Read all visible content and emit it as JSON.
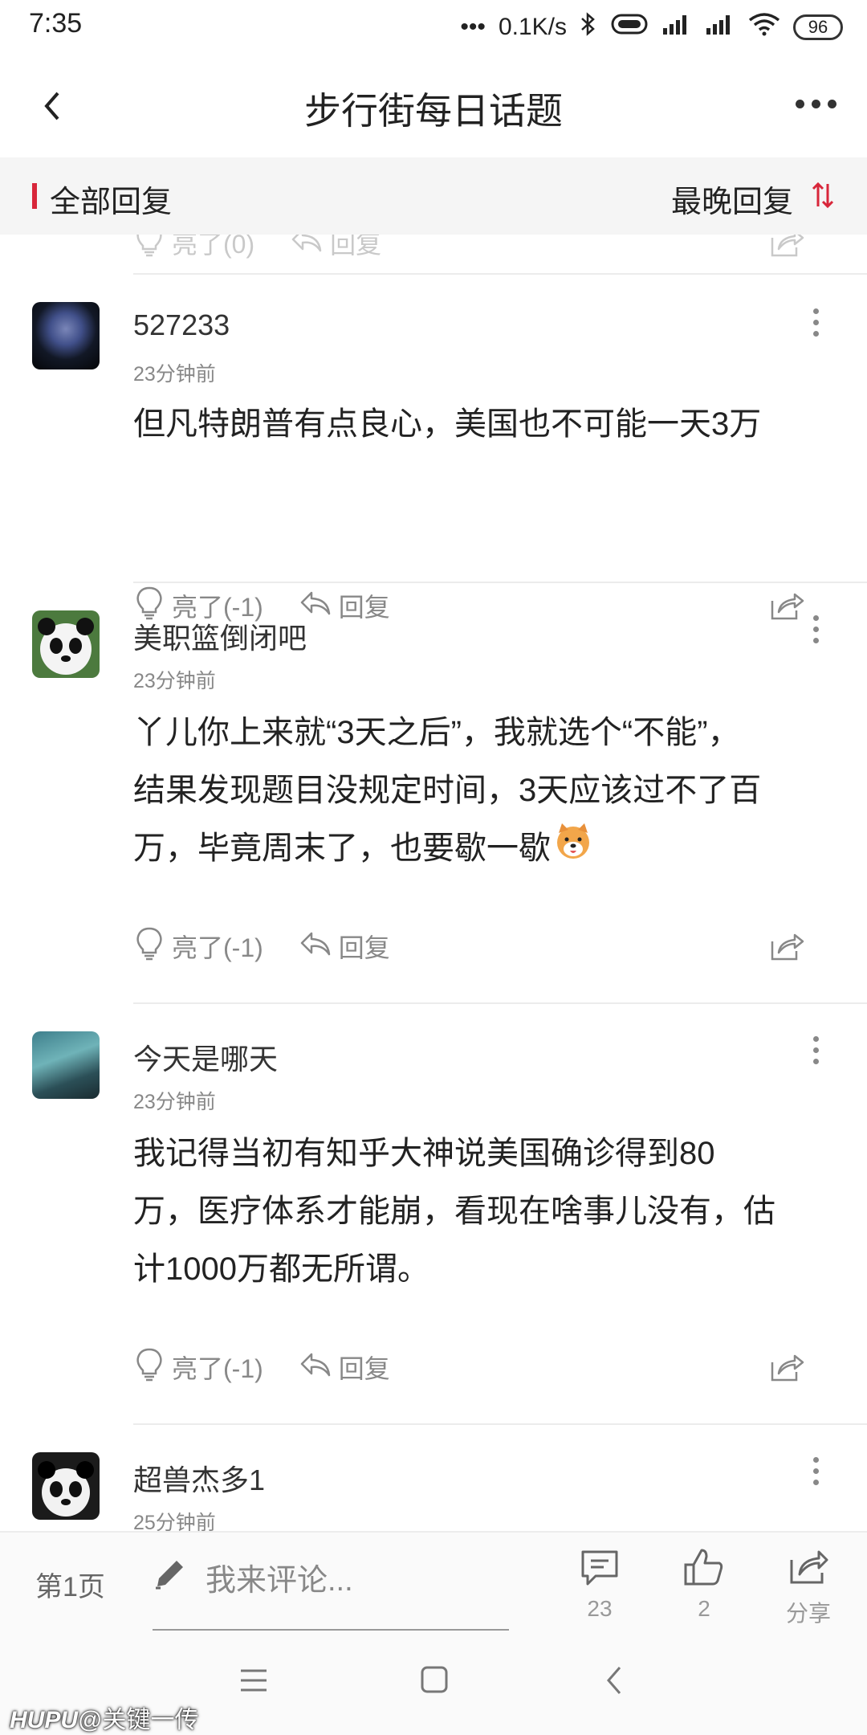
{
  "status_bar": {
    "time": "7:35",
    "speed": "0.1K/s",
    "battery": "96"
  },
  "header": {
    "title": "步行街每日话题"
  },
  "filter": {
    "label": "全部回复",
    "sort": "最晚回复"
  },
  "ghost_actions": {
    "like": "亮了(0)",
    "reply": "回复"
  },
  "posts": [
    {
      "user": "527233",
      "time": "23分钟前",
      "lines": [
        "但凡特朗普有点良心，美国也不可能一天3万"
      ],
      "like": "亮了(-1)",
      "reply": "回复"
    },
    {
      "user": "美职篮倒闭吧",
      "time": "23分钟前",
      "lines": [
        "丫儿你上来就“3天之后”，我就选个“不能”，",
        "结果发现题目没规定时间，3天应该过不了百",
        "万，毕竟周末了，也要歇一歇"
      ],
      "like": "亮了(-1)",
      "reply": "回复"
    },
    {
      "user": "今天是哪天",
      "time": "23分钟前",
      "lines": [
        "我记得当初有知乎大神说美国确诊得到80",
        "万，医疗体系才能崩，看现在啥事儿没有，估",
        "计1000万都无所谓。"
      ],
      "like": "亮了(-1)",
      "reply": "回复"
    },
    {
      "user": "超兽杰多1",
      "time": "25分钟前"
    }
  ],
  "bottom_bar": {
    "page": "第1页",
    "compose_placeholder": "我来评论...",
    "comments_count": "23",
    "likes_count": "2",
    "share_label": "分享"
  },
  "watermark": {
    "brand": "HUPU",
    "handle": "@关键一传"
  },
  "colors": {
    "accent": "#d8263a",
    "muted": "#888888"
  },
  "icons": [
    "back-icon",
    "more-icon",
    "sort-icon",
    "bulb-icon",
    "reply-icon",
    "share-icon",
    "pencil-icon",
    "comment-icon",
    "thumbs-up-icon",
    "menu-icon",
    "home-icon",
    "nav-back-icon"
  ]
}
